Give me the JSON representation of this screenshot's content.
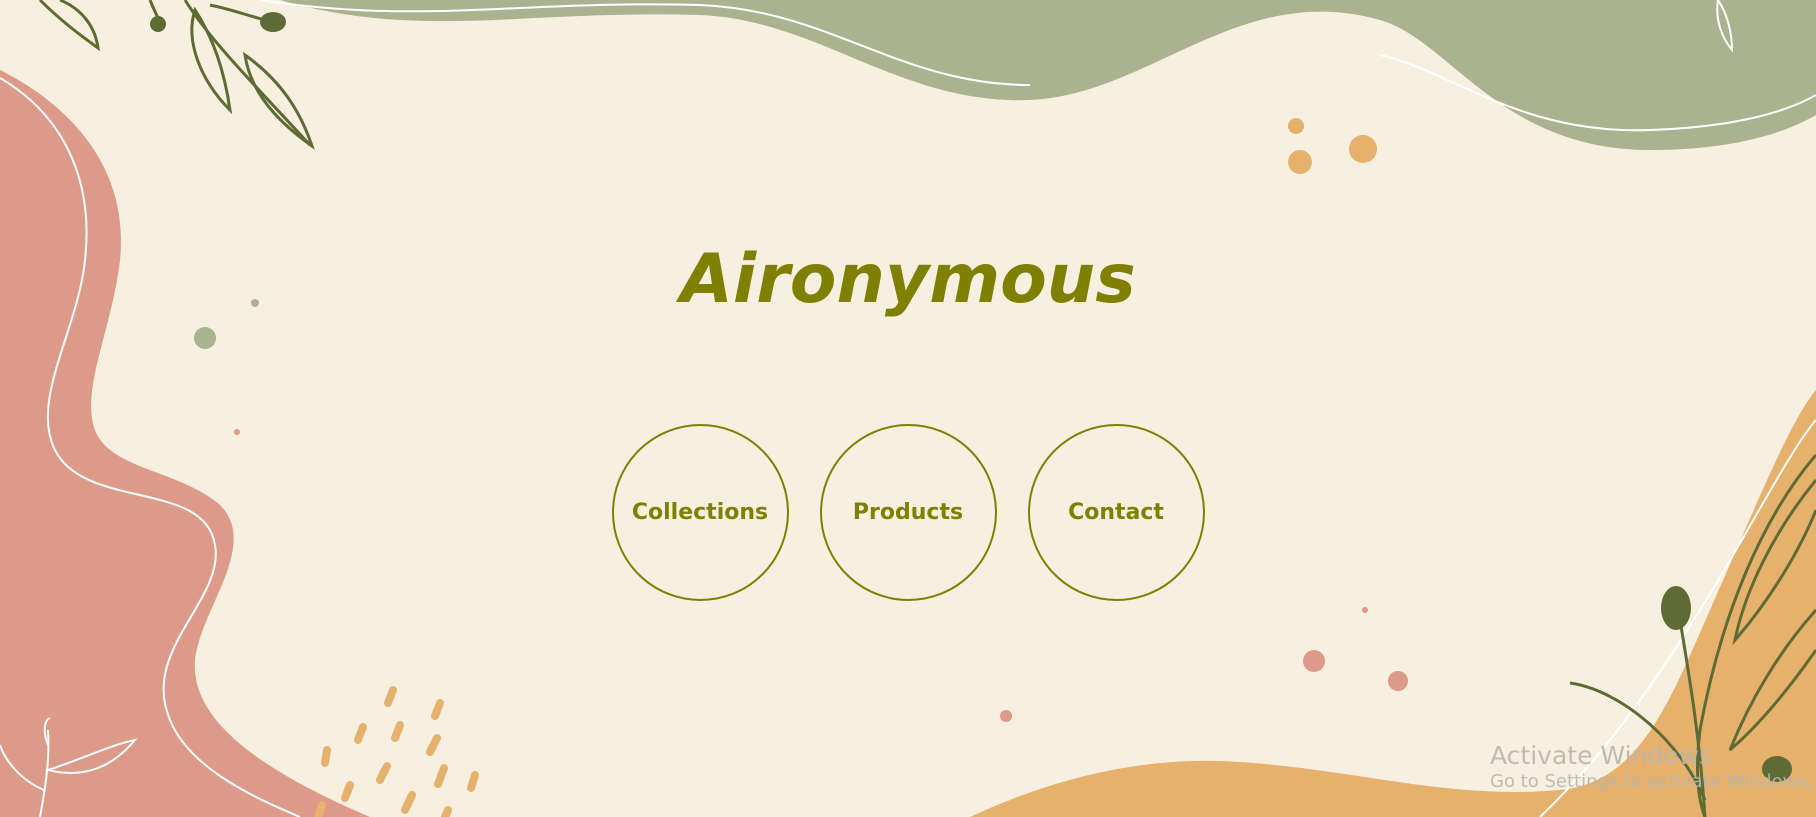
{
  "colors": {
    "background": "#f7efe0",
    "olive_accent": "#808000",
    "sage_green": "#abb28f",
    "terracotta": "#dd9a88",
    "mustard": "#e6b16d",
    "leaf_dark": "#5e6b34"
  },
  "hero": {
    "title": "Aironymous"
  },
  "nav": {
    "items": [
      {
        "label": "Collections",
        "icon": "circle-outline"
      },
      {
        "label": "Products",
        "icon": "circle-outline"
      },
      {
        "label": "Contact",
        "icon": "circle-outline"
      }
    ]
  },
  "os_watermark": {
    "title": "Activate Windows",
    "subtitle": "Go to Settings to activate Windows."
  }
}
